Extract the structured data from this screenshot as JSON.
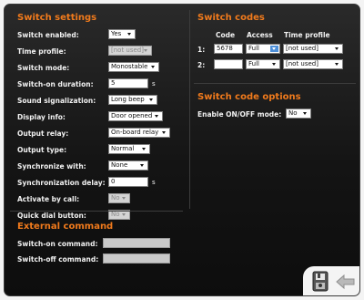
{
  "switch_settings": {
    "title": "Switch settings",
    "rows": [
      {
        "label": "Switch enabled:",
        "value": "Yes"
      },
      {
        "label": "Time profile:",
        "value": "[not used]"
      },
      {
        "label": "Switch mode:",
        "value": "Monostable"
      },
      {
        "label": "Switch-on duration:",
        "value": "5",
        "unit": "s"
      },
      {
        "label": "Sound signalization:",
        "value": "Long beep"
      },
      {
        "label": "Display info:",
        "value": "Door opened"
      },
      {
        "label": "Output relay:",
        "value": "On-board relay"
      },
      {
        "label": "Output type:",
        "value": "Normal"
      },
      {
        "label": "Synchronize with:",
        "value": "None"
      },
      {
        "label": "Synchronization delay:",
        "value": "0",
        "unit": "s"
      },
      {
        "label": "Activate by call:",
        "value": "No"
      },
      {
        "label": "Quick dial button:",
        "value": "No"
      }
    ]
  },
  "external_command": {
    "title": "External command",
    "switch_on_label": "Switch-on command:",
    "switch_on_value": "",
    "switch_off_label": "Switch-off command:",
    "switch_off_value": ""
  },
  "switch_codes": {
    "title": "Switch codes",
    "headers": {
      "code": "Code",
      "access": "Access",
      "time_profile": "Time profile"
    },
    "rows": [
      {
        "num": "1:",
        "code": "5678",
        "access": "Full",
        "time_profile": "[not used]"
      },
      {
        "num": "2:",
        "code": "",
        "access": "Full",
        "time_profile": "[not used]"
      }
    ]
  },
  "switch_code_options": {
    "title": "Switch code options",
    "enable_label": "Enable ON/OFF mode:",
    "enable_value": "No"
  },
  "icons": {
    "save": "save-icon",
    "back": "back-arrow-icon"
  },
  "colors": {
    "accent": "#f07a1c",
    "panel_bg": "#141414",
    "selection": "#4d8fd8"
  }
}
